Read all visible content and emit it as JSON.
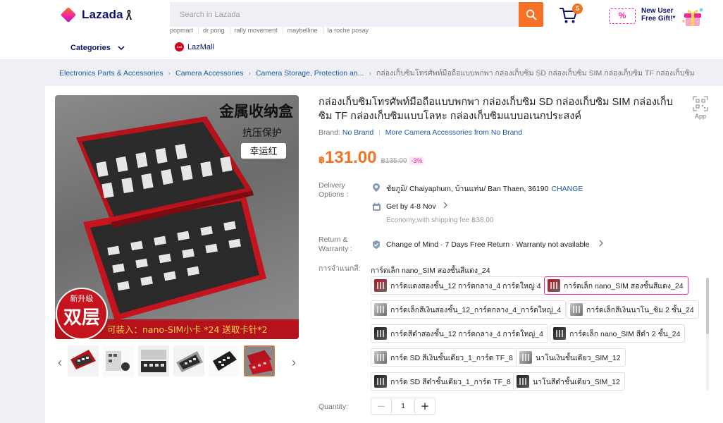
{
  "header": {
    "logo_text": "Lazada",
    "search_placeholder": "Search in Lazada",
    "suggestions": [
      "popmart",
      "dr pong",
      "rally movement",
      "maybelline",
      "la roche posay"
    ],
    "cart_count": "5",
    "promo": {
      "tag": "%",
      "line1": "New User",
      "line2": "Free Gift!*"
    },
    "categories_label": "Categories",
    "lazmall_label": "LazMall",
    "lazmall_badge": "Laz"
  },
  "breadcrumb": {
    "items": [
      "Electronics Parts & Accessories",
      "Camera Accessories",
      "Camera Storage, Protection an..."
    ],
    "current": "กล่องเก็บซิมโทรศัพท์มือถือแบบพกพา กล่องเก็บซิม SD กล่องเก็บซิม SIM กล่องเก็บซิม TF กล่องเก็บซิม"
  },
  "gallery": {
    "main_image_text": {
      "headline": "金属收纳盒",
      "subline": "抗压保护",
      "color_tag": "幸运红",
      "badge_top": "新升级",
      "badge_main": "双层",
      "bottom_caption": "可装入：nano-SIM小卡 *24  送取卡针*2"
    }
  },
  "product": {
    "title": "กล่องเก็บซิมโทรศัพท์มือถือแบบพกพา กล่องเก็บซิม SD กล่องเก็บซิม SIM กล่องเก็บซิม TF กล่องเก็บซิมแบบโลหะ กล่องเก็บซิมแบบอเนกประสงค์",
    "app_label": "App",
    "brand_label": "Brand:",
    "brand_name": "No Brand",
    "more_from": "More Camera Accessories from No Brand",
    "price_currency": "฿",
    "price_value": "131.00",
    "price_old": "฿135.00",
    "discount": "-3%"
  },
  "delivery": {
    "label": "Delivery Options :",
    "location": "ชัยภูมิ/ Chaiyaphum, บ้านแท่น/ Ban Thaen, 36190",
    "change_label": "CHANGE",
    "eta": "Get by 4-8 Nov",
    "shipping_note": "Economy,with shipping fee ฿38.00"
  },
  "warranty": {
    "label": "Return & Warranty :",
    "text": "Change of Mind · 7 Days Free Return · Warranty not available"
  },
  "variants": {
    "label": "การจำแนกสี:",
    "selected_name": "การ์ดเล็ก nano_SIM สองชั้นสีแดง_24",
    "options": [
      "การ์ดแดงสองชั้น_12 การ์ดกลาง_4 การ์ดใหญ่ 4",
      "การ์ดเล็ก nano_SIM สองชั้นสีแดง_24",
      "การ์ดเล็กสีเงินสองชั้น_12_การ์ดกลาง_4_การ์ดใหญ่_4",
      "การ์ดเล็กสีเงินนาโน_ซิม 2 ชั้น_24",
      "การ์ดสีดำสองชั้น_12 การ์ดกลาง_4 การ์ดใหญ่_4",
      "การ์ดเล็ก nano_SIM สีดำ 2 ชั้น_24",
      "การ์ด SD สีเงินชั้นเดียว_1_การ์ด TF_8",
      "นาโนเงินชั้นเดียว_SIM_12",
      "การ์ด SD สีดำชั้นเดียว_1_การ์ด TF_8",
      "นาโนสีดำชั้นเดียว_SIM_12"
    ]
  },
  "quantity": {
    "label": "Quantity:",
    "value": "1",
    "minus": "−",
    "plus": "+"
  },
  "colors": {
    "accent": "#f57224",
    "pink": "#f0249b",
    "link": "#1a5aa6",
    "navy": "#0f136d"
  }
}
